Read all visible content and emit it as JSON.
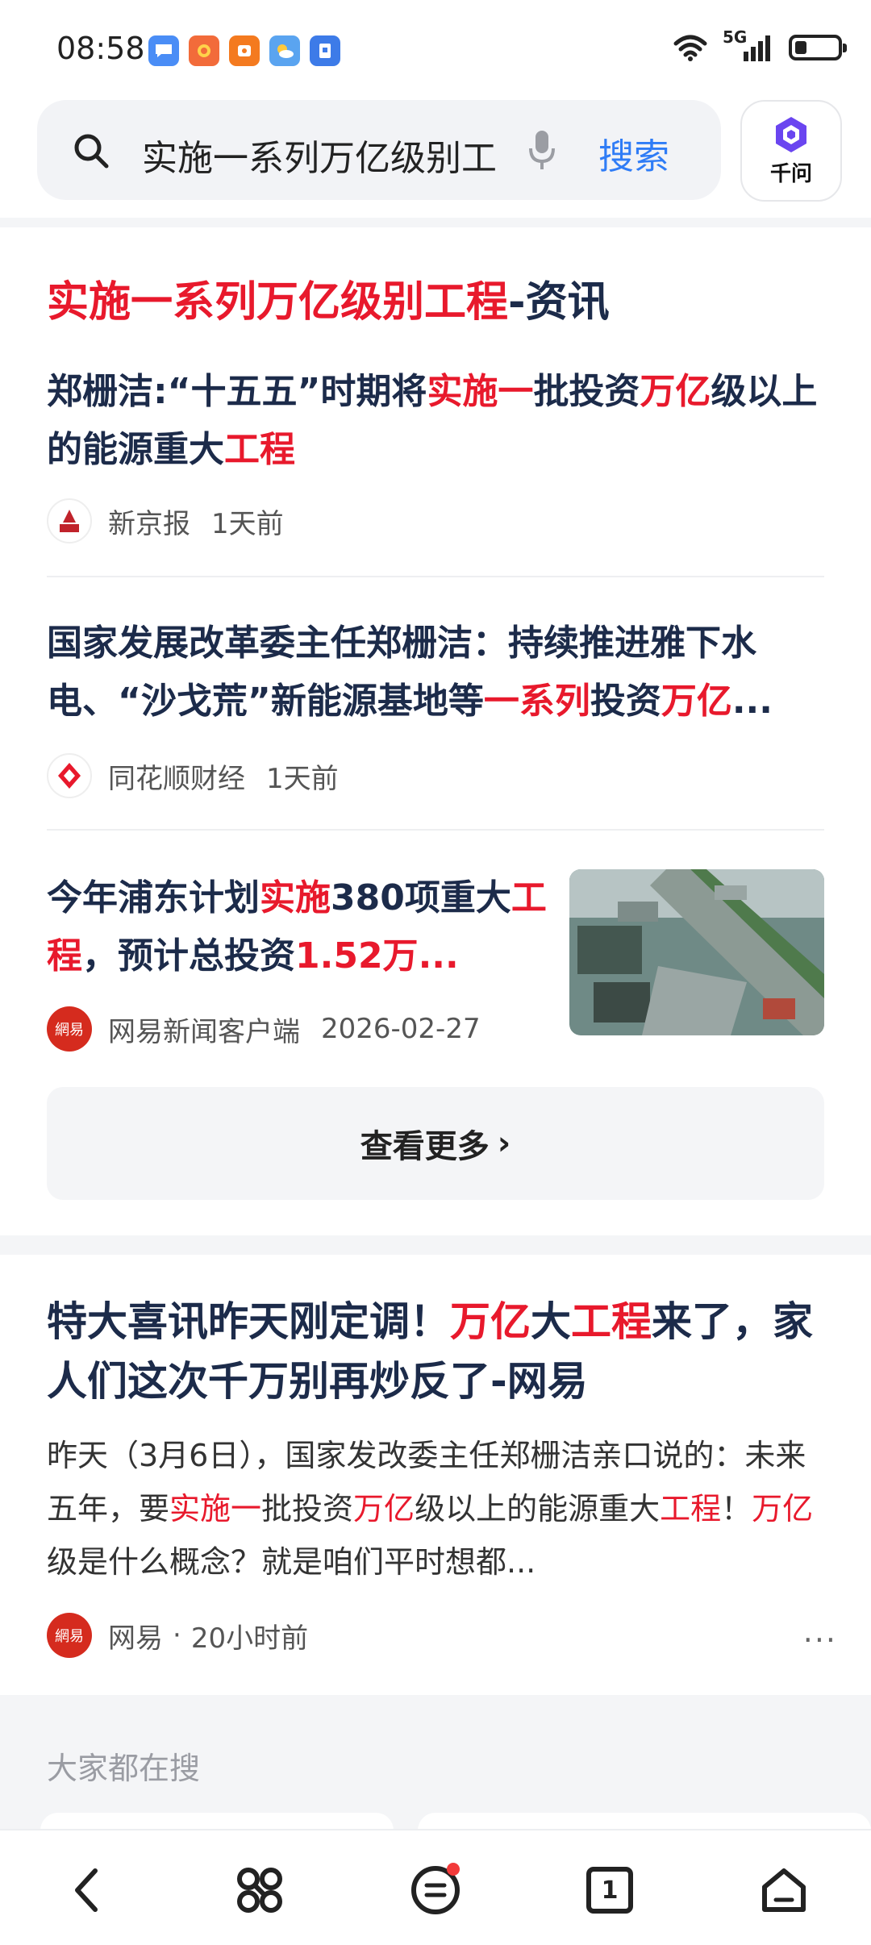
{
  "status_bar": {
    "time": "08:58",
    "network": "5G"
  },
  "search": {
    "query": "实施一系列万亿级别工",
    "search_button": "搜索",
    "qianwen_label": "千问"
  },
  "news_card": {
    "title_highlight": "实施一系列万亿级别工程",
    "title_suffix": "-资讯",
    "items": [
      {
        "title_parts": [
          "郑栅洁:“十五五”时期将",
          "实施一",
          "批投资",
          "万亿",
          "级以上的能源重大",
          "工程"
        ],
        "source": "新京报",
        "time": "1天前",
        "logo_text": "新京报"
      },
      {
        "title_parts": [
          "国家发展改革委主任郑栅洁：持续推进雅下水电、“沙戈荒”新能源基地等",
          "一系列",
          "投资",
          "万亿",
          "..."
        ],
        "source": "同花顺财经",
        "time": "1天前"
      },
      {
        "title_parts": [
          "今年浦东计划",
          "实施",
          "380项重大",
          "工程",
          "，预计总投资",
          "1.52万",
          "..."
        ],
        "source": "网易新闻客户端",
        "time": "2026-02-27",
        "logo_text": "網易"
      }
    ],
    "more_button": "查看更多",
    "more_chevron": "›"
  },
  "article": {
    "title_parts": [
      "特大喜讯昨天刚定调！",
      "万亿",
      "大",
      "工程",
      "来了，家人们这次千万别再炒反了-网易"
    ],
    "abstract_parts": [
      "昨天（3月6日），国家发改委主任郑栅洁亲口说的：未来五年，要",
      "实施一",
      "批投资",
      "万亿",
      "级以上的能源重大",
      "工程",
      "！",
      "万亿",
      "级是什么概念？就是咱们平时想都..."
    ],
    "source": "网易",
    "separator": "·",
    "time": "20小时前",
    "logo_text": "網易",
    "more_dots": "···"
  },
  "hot_search": {
    "title": "大家都在搜"
  },
  "bottom_nav": {
    "tab_count": "1"
  },
  "colors": {
    "highlight": "#e8192c",
    "link_blue": "#2f7cf6",
    "title_navy": "#1c2b4a"
  }
}
